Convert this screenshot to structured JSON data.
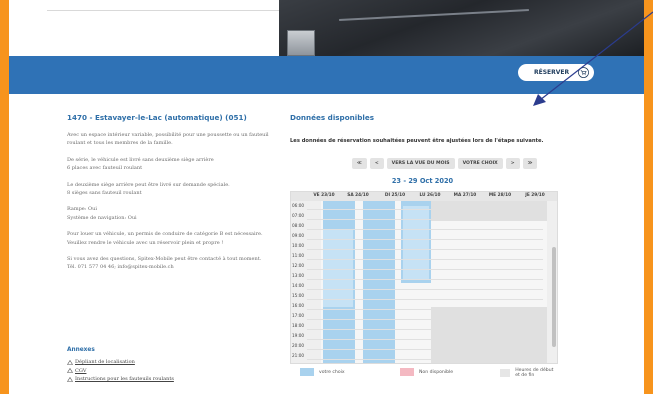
{
  "header": {
    "reserve_label": "RÉSERVER"
  },
  "vehicle": {
    "title": "1470 - Estavayer-le-Lac (automatique)  (051)",
    "paragraphs": [
      "Avec un espace intérieur variable, possibilité pour une poussette ou un fauteuil roulant et tous les membres de la famille.",
      "De série, le véhicule est livré sans deuxième siège arrière\n6 places avec fauteuil roulant",
      "Le deuxième siège arrière peut être livré sur demande spéciale.\n8 sièges sans fauteuil roulant",
      "Rampe: Oui\nSystème de navigation: Oui",
      "Pour louer un véhicule, un permis de conduire de catégorie B est nécessaire.\nVeuillez rendre le véhicule avec un réservoir plein et propre !",
      "Si vous avez des questions, Spitex-Mobile peut être contacté à tout moment.\nTél. 071 577 04 46; info@spitex-mobile.ch"
    ]
  },
  "annexes": {
    "title": "Annexes",
    "links": [
      "Dépliant de localisation",
      "CGV",
      "Instructions pour les fauteuils roulants"
    ]
  },
  "availability": {
    "title": "Données disponibles",
    "note": "Les données de réservation souhaitées peuvent être ajustées lors de l'étape suivante.",
    "nav": {
      "first": "≪",
      "prev": "<",
      "month_view": "VERS LA VUE DU MOIS",
      "your_choice": "VOTRE CHOIX",
      "next": ">",
      "last": "≫"
    },
    "date_range": "23 - 29 Oct 2020",
    "days": [
      "VE 23/10",
      "SA 24/10",
      "DI 25/10",
      "LU 26/10",
      "MA 27/10",
      "ME 28/10",
      "JE 29/10"
    ],
    "hours": [
      "06:00",
      "07:00",
      "08:00",
      "09:00",
      "10:00",
      "11:00",
      "12:00",
      "13:00",
      "14:00",
      "15:00",
      "16:00",
      "17:00",
      "18:00",
      "19:00",
      "20:00",
      "21:00"
    ],
    "legend": {
      "choice": "votre choix",
      "unavailable": "Non disponible",
      "hours": "Heures de début et de fin"
    },
    "colors": {
      "choice": "#a9d2ee",
      "unavailable": "#f4b9c2",
      "hours": "#e6e6e6",
      "accent": "#2f6fa8",
      "bar": "#2f72b6",
      "frame": "#f7941d"
    }
  }
}
